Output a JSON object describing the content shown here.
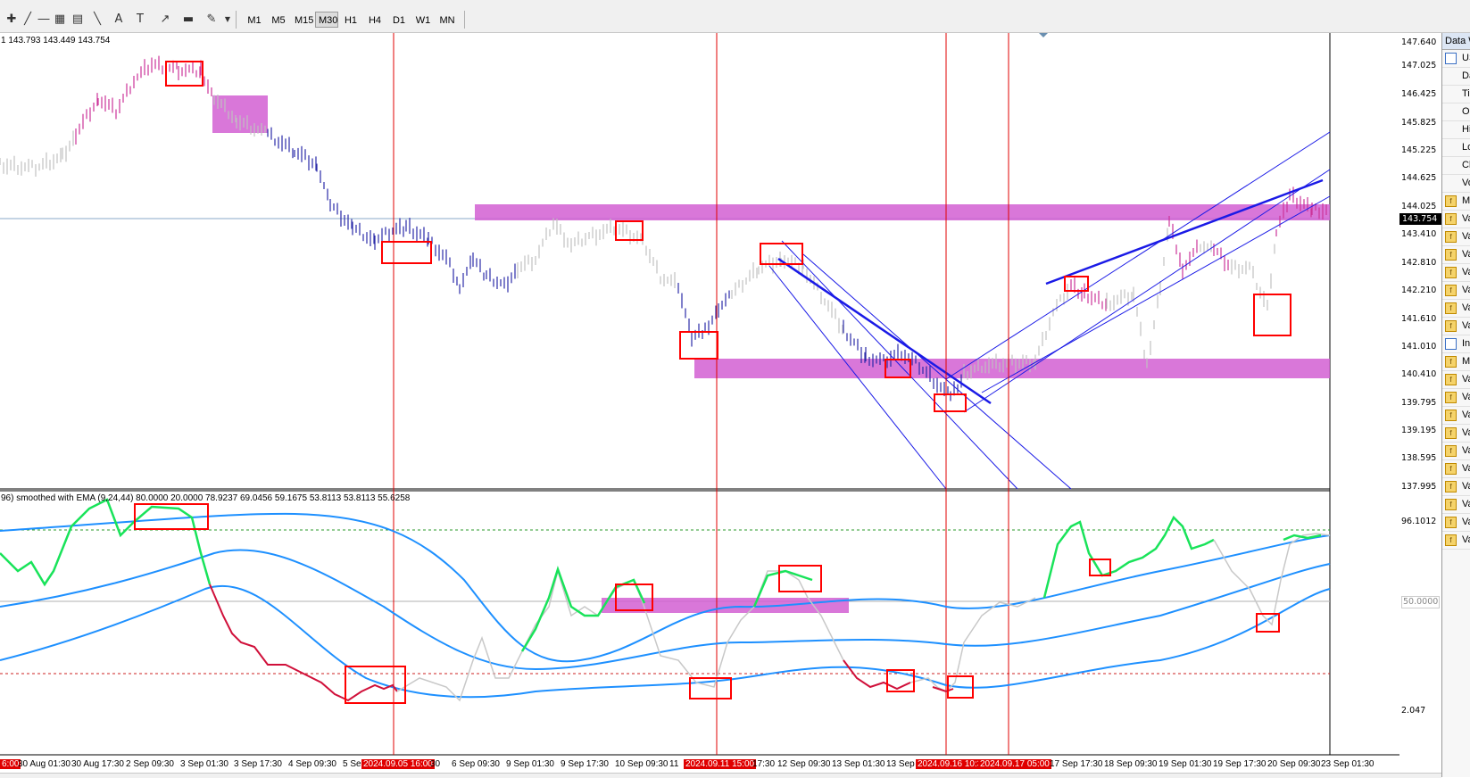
{
  "toolbar": {
    "timeframes": [
      "M1",
      "M5",
      "M15",
      "M30",
      "H1",
      "H4",
      "D1",
      "W1",
      "MN"
    ],
    "active_timeframe": "M30"
  },
  "main_chart": {
    "info": "1 143.793 143.449 143.754",
    "price_labels": [
      "147.640",
      "147.025",
      "146.425",
      "145.825",
      "145.225",
      "144.625",
      "144.025",
      "143.410",
      "142.810",
      "142.210",
      "141.610",
      "141.010",
      "140.410",
      "139.795",
      "139.195",
      "138.595",
      "137.995"
    ],
    "current_price": "143.754"
  },
  "indicator": {
    "info": "96) smoothed with EMA (9,24,44) 80.0000 20.0000 78.9237 69.0456 59.1675 53.8113 53.8113 55.6258",
    "labels": [
      "96.1012",
      "50.0000",
      "2.047"
    ]
  },
  "time_axis": {
    "labels": [
      "30 Aug 01:30",
      "30 Aug 17:30",
      "2 Sep 09:30",
      "3 Sep 01:30",
      "3 Sep 17:30",
      "4 Sep 09:30",
      "5 Se",
      "2024.09.05 16:00",
      "30",
      "6 Sep 09:30",
      "9 Sep 01:30",
      "9 Sep 17:30",
      "10 Sep 09:30",
      "11",
      "2024.09.11 15:00",
      "17:30",
      "12 Sep 09:30",
      "13 Sep 01:30",
      "13 Sep",
      "2024.09.16 10:30",
      "2024.09.17 05:00",
      "17 Sep 17:30",
      "18 Sep 09:30",
      "19 Sep 01:30",
      "19 Sep 17:30",
      "20 Sep 09:30",
      "23 Sep 01:30"
    ],
    "left_stub": "6:00"
  },
  "data_window": {
    "title": "Data W",
    "rows": [
      {
        "icon": "chart",
        "text": "US"
      },
      {
        "icon": "none",
        "text": "Da"
      },
      {
        "icon": "none",
        "text": "Ti"
      },
      {
        "icon": "none",
        "text": "Op"
      },
      {
        "icon": "none",
        "text": "Hi"
      },
      {
        "icon": "none",
        "text": "Lo"
      },
      {
        "icon": "none",
        "text": "Cl"
      },
      {
        "icon": "none",
        "text": "Vo"
      },
      {
        "icon": "func",
        "text": "M"
      },
      {
        "icon": "func",
        "text": "Va"
      },
      {
        "icon": "func",
        "text": "Va"
      },
      {
        "icon": "func",
        "text": "Va"
      },
      {
        "icon": "func",
        "text": "Va"
      },
      {
        "icon": "func",
        "text": "Va"
      },
      {
        "icon": "func",
        "text": "Va"
      },
      {
        "icon": "func",
        "text": "Va"
      },
      {
        "icon": "chart",
        "text": "In"
      },
      {
        "icon": "func",
        "text": "M"
      },
      {
        "icon": "func",
        "text": "Va"
      },
      {
        "icon": "func",
        "text": "Va"
      },
      {
        "icon": "func",
        "text": "Va"
      },
      {
        "icon": "func",
        "text": "Va"
      },
      {
        "icon": "func",
        "text": "Va"
      },
      {
        "icon": "func",
        "text": "Va"
      },
      {
        "icon": "func",
        "text": "Va"
      },
      {
        "icon": "func",
        "text": "Va"
      },
      {
        "icon": "func",
        "text": "Va"
      },
      {
        "icon": "func",
        "text": "Va"
      }
    ]
  },
  "colors": {
    "bull": "#cc3399",
    "bear": "#2a2aa8",
    "neutral": "#c0c0c0",
    "zone": "#d25fd2",
    "marker": "#ff0000",
    "band": "#1e90ff",
    "osc_up": "#19e35a",
    "osc_down": "#d0103a"
  }
}
